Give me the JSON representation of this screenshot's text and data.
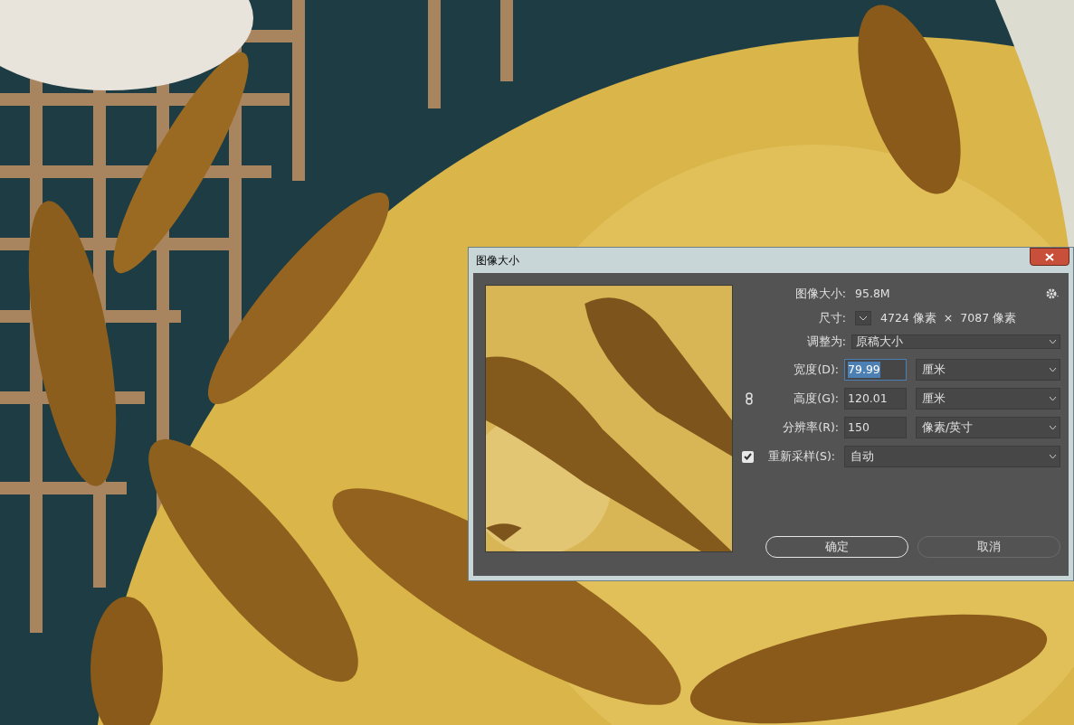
{
  "dialog": {
    "title": "图像大小",
    "image_size": {
      "label": "图像大小:",
      "value": "95.8M"
    },
    "dimensions": {
      "label": "尺寸:",
      "width": "4724 像素",
      "times": "×",
      "height": "7087 像素"
    },
    "fit_to": {
      "label": "调整为:",
      "value": "原稿大小"
    },
    "fields": [
      {
        "label": "宽度(D):",
        "value": "79.99",
        "unit": "厘米",
        "selected": true
      },
      {
        "label": "高度(G):",
        "value": "120.01",
        "unit": "厘米",
        "selected": false
      },
      {
        "label": "分辨率(R):",
        "value": "150",
        "unit": "像素/英寸",
        "selected": false
      }
    ],
    "resample": {
      "label": "重新采样(S):",
      "checked": true,
      "value": "自动"
    },
    "buttons": [
      {
        "label": "确定",
        "default": true
      },
      {
        "label": "取消",
        "default": false
      }
    ]
  }
}
